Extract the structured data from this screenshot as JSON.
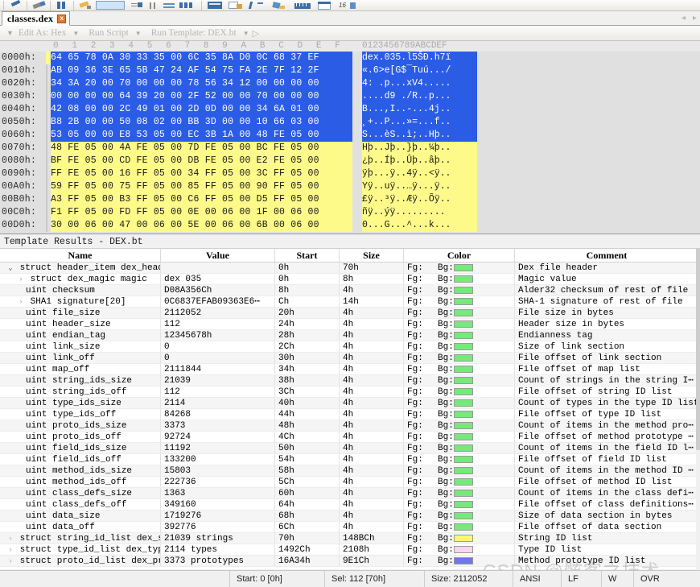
{
  "toolbar": {
    "icons": [
      "pencil-icon",
      "eraser-icon",
      "columns-icon",
      "highlighter-icon",
      "color-swatch-icon",
      "wrap-icon",
      "pause-icon",
      "equals-icon",
      "binary-icon",
      "table-icon",
      "export-icon",
      "checkmark-icon",
      "compare-icon",
      "ruler-icon",
      "window-icon",
      "hex16-icon"
    ]
  },
  "tab": {
    "label": "classes.dex",
    "close": "x",
    "prev_arrow": "◂",
    "next_arrow": "▸"
  },
  "template_toolbar": {
    "grip": "▼",
    "edit_as_label": "Edit As: Hex",
    "edit_as_caret": "▼",
    "run_script_label": "Run Script",
    "run_script_caret": "▼",
    "run_template_label": "Run Template: DEX.bt",
    "run_template_caret": "▼",
    "play": "▷"
  },
  "hex": {
    "ruler_cols": [
      "0",
      "1",
      "2",
      "3",
      "4",
      "5",
      "6",
      "7",
      "8",
      "9",
      "A",
      "B",
      "C",
      "D",
      "E",
      "F"
    ],
    "ascii_ruler": "0123456789ABCDEF",
    "rows": [
      {
        "offset": "0000h:",
        "bytes": "64 65 78 0A 30 33 35 00 6C 35 8A D0 0C 68 37 EF",
        "ascii": "dex.035.l5ŠÐ.h7ï",
        "sel": "blue",
        "cursor": true
      },
      {
        "offset": "0010h:",
        "bytes": "AB 09 36 3E 65 5B 47 24 AF 54 75 FA 2E 7F 12 2F",
        "ascii": "«.6>e[G$¯Tuú.../",
        "sel": "blue",
        "cursor": false
      },
      {
        "offset": "0020h:",
        "bytes": "34 3A 20 00 70 00 00 00 78 56 34 12 00 00 00 00",
        "ascii": "4: .p...xV4.....",
        "sel": "blue",
        "cursor": false
      },
      {
        "offset": "0030h:",
        "bytes": "00 00 00 00 64 39 20 00 2F 52 00 00 70 00 00 00",
        "ascii": "....d9 ./R..p...",
        "sel": "blue",
        "cursor": false
      },
      {
        "offset": "0040h:",
        "bytes": "42 08 00 00 2C 49 01 00 2D 0D 00 00 34 6A 01 00",
        "ascii": "B...,I..-...4j..",
        "sel": "blue",
        "cursor": false
      },
      {
        "offset": "0050h:",
        "bytes": "B8 2B 00 00 50 08 02 00 BB 3D 00 00 10 66 03 00",
        "ascii": "¸+..P...»=...f..",
        "sel": "blue",
        "cursor": false
      },
      {
        "offset": "0060h:",
        "bytes": "53 05 00 00 E8 53 05 00 EC 3B 1A 00 48 FE 05 00",
        "ascii": "S...èS..ì;..Hþ..",
        "sel": "blue",
        "cursor": false
      },
      {
        "offset": "0070h:",
        "bytes": "48 FE 05 00 4A FE 05 00 7D FE 05 00 BC FE 05 00",
        "ascii": "Hþ..Jþ..}þ..¼þ..",
        "sel": "yellow",
        "cursor": false
      },
      {
        "offset": "0080h:",
        "bytes": "BF FE 05 00 CD FE 05 00 DB FE 05 00 E2 FE 05 00",
        "ascii": "¿þ..Íþ..Ûþ..âþ..",
        "sel": "yellow",
        "cursor": false
      },
      {
        "offset": "0090h:",
        "bytes": "FF FE 05 00 16 FF 05 00 34 FF 05 00 3C FF 05 00",
        "ascii": "ÿþ...ÿ..4ÿ..<ÿ..",
        "sel": "yellow",
        "cursor": false
      },
      {
        "offset": "00A0h:",
        "bytes": "59 FF 05 00 75 FF 05 00 85 FF 05 00 90 FF 05 00",
        "ascii": "Yÿ..uÿ..…ÿ...ÿ..",
        "sel": "yellow",
        "cursor": false
      },
      {
        "offset": "00B0h:",
        "bytes": "A3 FF 05 00 B3 FF 05 00 C6 FF 05 00 D5 FF 05 00",
        "ascii": "£ÿ..³ÿ..Æÿ..Õÿ..",
        "sel": "yellow",
        "cursor": false
      },
      {
        "offset": "00C0h:",
        "bytes": "F1 FF 05 00 FD FF 05 00 0E 00 06 00 1F 00 06 00",
        "ascii": "ñÿ..ýÿ.........",
        "sel": "yellow",
        "cursor": false
      },
      {
        "offset": "00D0h:",
        "bytes": "30 00 06 00 47 00 06 00 5E 00 06 00 6B 00 06 00",
        "ascii": "0...G...^...k...",
        "sel": "yellow",
        "cursor": false
      }
    ]
  },
  "results": {
    "title": "Template Results - DEX.bt",
    "columns": [
      "Name",
      "Value",
      "Start",
      "Size",
      "Color",
      "Comment"
    ],
    "fg_label": "Fg:",
    "bg_label": "Bg:",
    "rows": [
      {
        "indent": 0,
        "twisty": "⌄",
        "twisty_color": "dark",
        "name": "struct header_item dex_header",
        "value": "",
        "start": "0h",
        "size": "70h",
        "color": "#77e87a",
        "comment": "Dex file header"
      },
      {
        "indent": 1,
        "twisty": "›",
        "twisty_color": "gray",
        "name": "struct dex_magic magic",
        "value": "dex 035",
        "start": "0h",
        "size": "8h",
        "color": "#77e87a",
        "comment": "Magic value"
      },
      {
        "indent": 2,
        "twisty": "",
        "twisty_color": "gray",
        "name": "uint checksum",
        "value": "D08A356Ch",
        "start": "8h",
        "size": "4h",
        "color": "#77e87a",
        "comment": "Alder32 checksum of rest of file"
      },
      {
        "indent": 1,
        "twisty": "›",
        "twisty_color": "gray",
        "name": "SHA1 signature[20]",
        "value": "0C6837EFAB09363E6⋯",
        "start": "Ch",
        "size": "14h",
        "color": "#77e87a",
        "comment": "SHA-1 signature of rest of file"
      },
      {
        "indent": 2,
        "twisty": "",
        "twisty_color": "gray",
        "name": "uint file_size",
        "value": "2112052",
        "start": "20h",
        "size": "4h",
        "color": "#77e87a",
        "comment": "File size in bytes"
      },
      {
        "indent": 2,
        "twisty": "",
        "twisty_color": "gray",
        "name": "uint header_size",
        "value": "112",
        "start": "24h",
        "size": "4h",
        "color": "#77e87a",
        "comment": "Header size in bytes"
      },
      {
        "indent": 2,
        "twisty": "",
        "twisty_color": "gray",
        "name": "uint endian_tag",
        "value": "12345678h",
        "start": "28h",
        "size": "4h",
        "color": "#77e87a",
        "comment": "Endianness tag"
      },
      {
        "indent": 2,
        "twisty": "",
        "twisty_color": "gray",
        "name": "uint link_size",
        "value": "0",
        "start": "2Ch",
        "size": "4h",
        "color": "#77e87a",
        "comment": "Size of link section"
      },
      {
        "indent": 2,
        "twisty": "",
        "twisty_color": "gray",
        "name": "uint link_off",
        "value": "0",
        "start": "30h",
        "size": "4h",
        "color": "#77e87a",
        "comment": "File offset of link section"
      },
      {
        "indent": 2,
        "twisty": "",
        "twisty_color": "gray",
        "name": "uint map_off",
        "value": "2111844",
        "start": "34h",
        "size": "4h",
        "color": "#77e87a",
        "comment": "File offset of map list"
      },
      {
        "indent": 2,
        "twisty": "",
        "twisty_color": "gray",
        "name": "uint string_ids_size",
        "value": "21039",
        "start": "38h",
        "size": "4h",
        "color": "#77e87a",
        "comment": "Count of strings in the string I⋯"
      },
      {
        "indent": 2,
        "twisty": "",
        "twisty_color": "gray",
        "name": "uint string_ids_off",
        "value": "112",
        "start": "3Ch",
        "size": "4h",
        "color": "#77e87a",
        "comment": "File offset of string ID list"
      },
      {
        "indent": 2,
        "twisty": "",
        "twisty_color": "gray",
        "name": "uint type_ids_size",
        "value": "2114",
        "start": "40h",
        "size": "4h",
        "color": "#77e87a",
        "comment": "Count of types in the type ID list"
      },
      {
        "indent": 2,
        "twisty": "",
        "twisty_color": "gray",
        "name": "uint type_ids_off",
        "value": "84268",
        "start": "44h",
        "size": "4h",
        "color": "#77e87a",
        "comment": "File offset of type ID list"
      },
      {
        "indent": 2,
        "twisty": "",
        "twisty_color": "gray",
        "name": "uint proto_ids_size",
        "value": "3373",
        "start": "48h",
        "size": "4h",
        "color": "#77e87a",
        "comment": "Count of items in the method pro⋯"
      },
      {
        "indent": 2,
        "twisty": "",
        "twisty_color": "gray",
        "name": "uint proto_ids_off",
        "value": "92724",
        "start": "4Ch",
        "size": "4h",
        "color": "#77e87a",
        "comment": "File offset of method prototype ⋯"
      },
      {
        "indent": 2,
        "twisty": "",
        "twisty_color": "gray",
        "name": "uint field_ids_size",
        "value": "11192",
        "start": "50h",
        "size": "4h",
        "color": "#77e87a",
        "comment": "Count of items in the field ID l⋯"
      },
      {
        "indent": 2,
        "twisty": "",
        "twisty_color": "gray",
        "name": "uint field_ids_off",
        "value": "133200",
        "start": "54h",
        "size": "4h",
        "color": "#77e87a",
        "comment": "File offset of field ID list"
      },
      {
        "indent": 2,
        "twisty": "",
        "twisty_color": "gray",
        "name": "uint method_ids_size",
        "value": "15803",
        "start": "58h",
        "size": "4h",
        "color": "#77e87a",
        "comment": "Count of items in the method ID ⋯"
      },
      {
        "indent": 2,
        "twisty": "",
        "twisty_color": "gray",
        "name": "uint method_ids_off",
        "value": "222736",
        "start": "5Ch",
        "size": "4h",
        "color": "#77e87a",
        "comment": "File offset of method ID list"
      },
      {
        "indent": 2,
        "twisty": "",
        "twisty_color": "gray",
        "name": "uint class_defs_size",
        "value": "1363",
        "start": "60h",
        "size": "4h",
        "color": "#77e87a",
        "comment": "Count of items in the class defi⋯"
      },
      {
        "indent": 2,
        "twisty": "",
        "twisty_color": "gray",
        "name": "uint class_defs_off",
        "value": "349160",
        "start": "64h",
        "size": "4h",
        "color": "#77e87a",
        "comment": "File offset of class definitions⋯"
      },
      {
        "indent": 2,
        "twisty": "",
        "twisty_color": "gray",
        "name": "uint data_size",
        "value": "1719276",
        "start": "68h",
        "size": "4h",
        "color": "#77e87a",
        "comment": "Size of data section in bytes"
      },
      {
        "indent": 2,
        "twisty": "",
        "twisty_color": "gray",
        "name": "uint data_off",
        "value": "392776",
        "start": "6Ch",
        "size": "4h",
        "color": "#77e87a",
        "comment": "File offset of data section"
      },
      {
        "indent": 0,
        "twisty": "›",
        "twisty_color": "gray",
        "name": "struct string_id_list dex_str⋯",
        "value": "21039 strings",
        "start": "70h",
        "size": "148BCh",
        "color": "#fdf47a",
        "comment": "String ID list"
      },
      {
        "indent": 0,
        "twisty": "›",
        "twisty_color": "gray",
        "name": "struct type_id_list dex_type_⋯",
        "value": "2114 types",
        "start": "1492Ch",
        "size": "2108h",
        "color": "#f8d6ee",
        "comment": "Type ID list"
      },
      {
        "indent": 0,
        "twisty": "›",
        "twisty_color": "gray",
        "name": "struct proto_id_list dex_prot⋯",
        "value": "3373 prototypes",
        "start": "16A34h",
        "size": "9E1Ch",
        "color": "#6f76ea",
        "comment": "Method prototype ID list"
      }
    ]
  },
  "status": {
    "start": "Start: 0 [0h]",
    "sel": "Sel: 112 [70h]",
    "size": "Size: 2112052",
    "encoding": "ANSI",
    "linefeed": "LF",
    "write": "W",
    "overwrite": "OVR"
  },
  "watermark": "CSDN @骸客之技术"
}
